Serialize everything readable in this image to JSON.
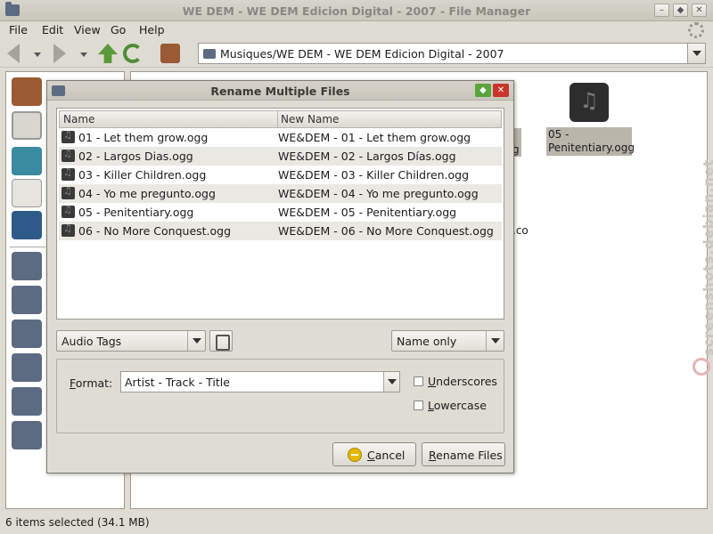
{
  "window": {
    "title": "WE DEM - WE DEM Edicion Digital - 2007 - File Manager"
  },
  "menu": [
    "File",
    "Edit",
    "View",
    "Go",
    "Help"
  ],
  "location": {
    "path": "Musiques/WE DEM - WE DEM Edicion Digital - 2007"
  },
  "background": {
    "file_label": "05 - Penitentiary.ogg",
    "fragment_1": "g",
    "fragment_2": ".co"
  },
  "status_bar": "6 items selected (34.1 MB)",
  "watermark": "screenshots.debian.net",
  "dialog": {
    "title": "Rename Multiple Files",
    "columns": [
      "Name",
      "New Name"
    ],
    "rows": [
      {
        "name": "01 - Let them grow.ogg",
        "new_name": "WE&DEM - 01 - Let them grow.ogg"
      },
      {
        "name": "02 - Largos Dias.ogg",
        "new_name": "WE&DEM - 02 - Largos Días.ogg"
      },
      {
        "name": "03 - Killer Children.ogg",
        "new_name": "WE&DEM - 03 - Killer Children.ogg"
      },
      {
        "name": "04 - Yo me pregunto.ogg",
        "new_name": "WE&DEM - 04 - Yo me pregunto.ogg"
      },
      {
        "name": "05 - Penitentiary.ogg",
        "new_name": "WE&DEM - 05 - Penitentiary.ogg"
      },
      {
        "name": "06 - No More Conquest.ogg",
        "new_name": "WE&DEM - 06 - No More Conquest.ogg"
      }
    ],
    "source_select": "Audio Tags",
    "scope_select": "Name only",
    "format_label_pre": "",
    "format_label_mnemonic": "F",
    "format_label_post": "ormat:",
    "format_value": "Artist - Track - Title",
    "underscores": {
      "mnemonic": "U",
      "rest": "nderscores",
      "checked": false
    },
    "lowercase": {
      "mnemonic": "L",
      "rest": "owercase",
      "checked": false
    },
    "cancel": {
      "mnemonic": "C",
      "rest": "ancel"
    },
    "rename": {
      "mnemonic": "R",
      "rest": "ename Files"
    }
  },
  "colors": {
    "window_bg": "#dfdcd3",
    "selection": "#b9b5ab",
    "close_button": "#c9352b",
    "maximize_button": "#5aa43c"
  }
}
